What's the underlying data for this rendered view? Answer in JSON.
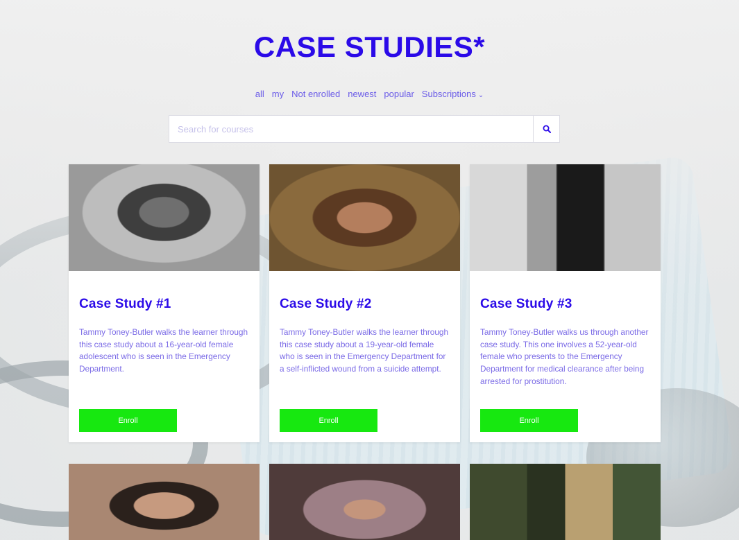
{
  "page": {
    "title": "CASE STUDIES*"
  },
  "filters": {
    "items": [
      "all",
      "my",
      "Not enrolled",
      "newest",
      "popular"
    ],
    "subscriptions_label": "Subscriptions"
  },
  "search": {
    "placeholder": "Search for courses",
    "value": ""
  },
  "cards": [
    {
      "title": "Case Study #1",
      "description": "Tammy Toney-Butler walks the learner through this case study about a 16-year-old female adolescent who is seen in the Emergency Department.",
      "button_label": "Enroll"
    },
    {
      "title": "Case Study #2",
      "description": "Tammy Toney-Butler walks the learner through this case study about a 19-year-old female who is seen in the Emergency Department for a self-inflicted wound from a suicide attempt.",
      "button_label": "Enroll"
    },
    {
      "title": "Case Study #3",
      "description": "Tammy Toney-Butler walks us through another case study. This one involves a 52-year-old female who presents to the Emergency Department for medical clearance after being arrested for prostitution.",
      "button_label": "Enroll"
    }
  ],
  "colors": {
    "accent": "#2b0ae8",
    "text_muted": "#7a6ae6",
    "enroll_button": "#17e810"
  }
}
